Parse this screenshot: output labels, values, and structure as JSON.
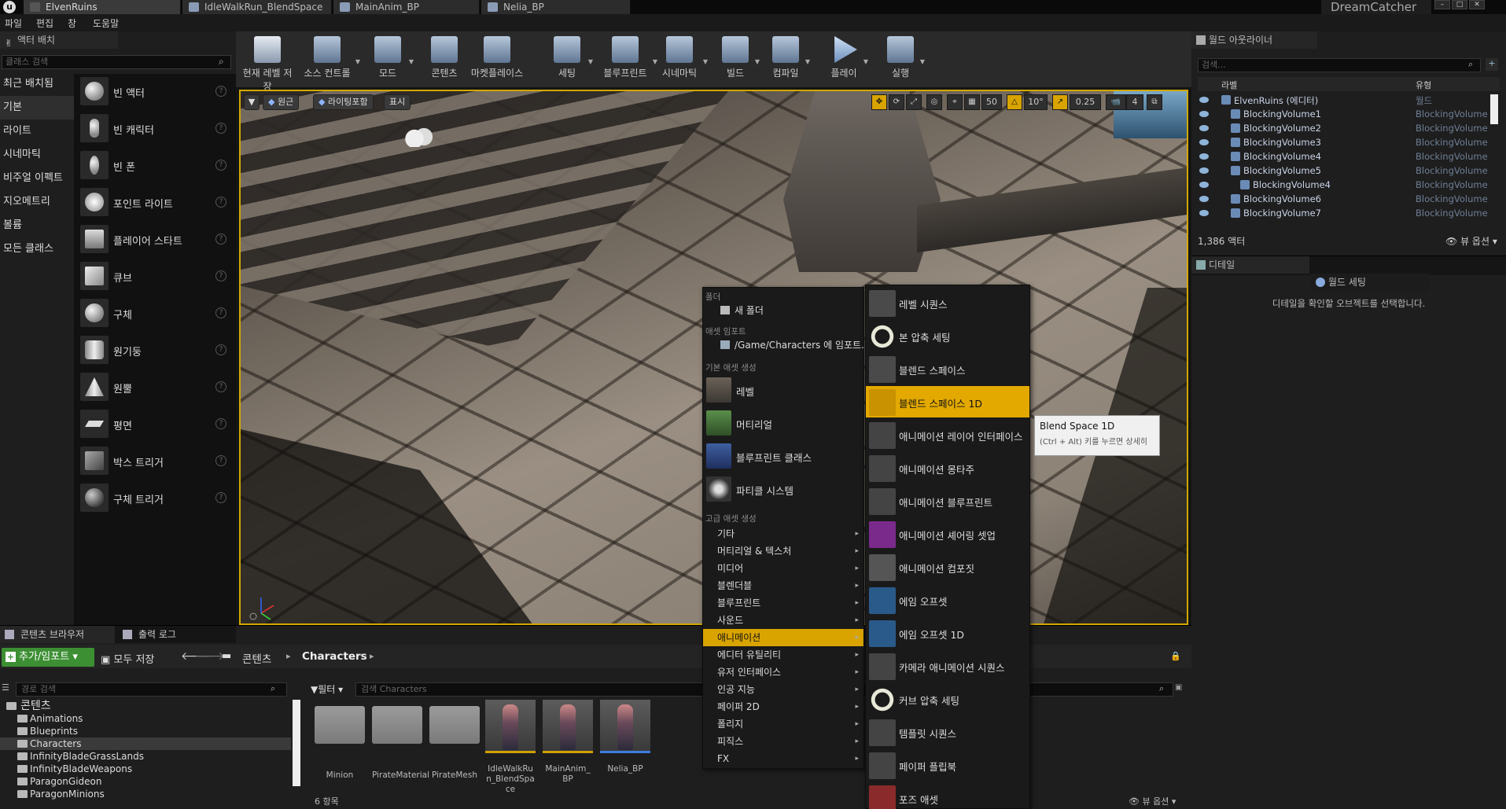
{
  "titlebar": {
    "tabs": [
      {
        "label": "ElvenRuins"
      },
      {
        "label": "IdleWalkRun_BlendSpace"
      },
      {
        "label": "MainAnim_BP"
      },
      {
        "label": "Nelia_BP"
      }
    ],
    "project": "DreamCatcher"
  },
  "menubar": {
    "items": [
      "파일",
      "편집",
      "창",
      "도움말"
    ]
  },
  "modes": {
    "tab": "액터 배치",
    "search_placeholder": "클래스 검색",
    "categories": [
      "최근 배치됨",
      "기본",
      "라이트",
      "시네마틱",
      "비주얼 이펙트",
      "지오메트리",
      "볼륨",
      "모든 클래스"
    ],
    "items": [
      "빈 액터",
      "빈 캐릭터",
      "빈 폰",
      "포인트 라이트",
      "플레이어 스타트",
      "큐브",
      "구체",
      "원기둥",
      "원뿔",
      "평면",
      "박스 트리거",
      "구체 트리거"
    ]
  },
  "toolbar": {
    "buttons": [
      "현재 레벨 저장",
      "소스 컨트롤",
      "모드",
      "콘텐츠",
      "마켓플레이스",
      "세팅",
      "블루프린트",
      "시네마틱",
      "빌드",
      "컴파일",
      "플레이",
      "실행"
    ]
  },
  "viewport": {
    "perspective": "원근",
    "lighting": "라이팅포함",
    "show": "표시",
    "grid_snap": "50",
    "rot_snap": "10°",
    "scale_snap": "0.25",
    "cam_speed": "4"
  },
  "outliner": {
    "tab": "월드 아웃라이너",
    "search_placeholder": "검색...",
    "col_label": "라벨",
    "col_type": "유형",
    "rows": [
      {
        "label": "ElvenRuins (에디터)",
        "type": "월드",
        "indent": 0
      },
      {
        "label": "BlockingVolume1",
        "type": "BlockingVolume",
        "indent": 1
      },
      {
        "label": "BlockingVolume2",
        "type": "BlockingVolume",
        "indent": 1
      },
      {
        "label": "BlockingVolume3",
        "type": "BlockingVolume",
        "indent": 1
      },
      {
        "label": "BlockingVolume4",
        "type": "BlockingVolume",
        "indent": 1
      },
      {
        "label": "BlockingVolume5",
        "type": "BlockingVolume",
        "indent": 1
      },
      {
        "label": "BlockingVolume4",
        "type": "BlockingVolume",
        "indent": 2
      },
      {
        "label": "BlockingVolume6",
        "type": "BlockingVolume",
        "indent": 1
      },
      {
        "label": "BlockingVolume7",
        "type": "BlockingVolume",
        "indent": 1
      }
    ],
    "actor_count": "1,386 액터",
    "view_options": "뷰 옵션"
  },
  "details": {
    "tab": "디테일",
    "tab2": "월드 세팅",
    "empty_msg": "디테일을 확인할 오브젝트를 선택합니다."
  },
  "content_browser": {
    "tab": "콘텐츠 브라우저",
    "tab2": "출력 로그",
    "add_import": "추가/임포트",
    "save_all": "모두 저장",
    "crumb_root": "콘텐츠",
    "crumb_current": "Characters",
    "path_search_placeholder": "경로 검색",
    "filter": "필터",
    "asset_search_placeholder": "검색 Characters",
    "tree": [
      "콘텐츠",
      "Animations",
      "Blueprints",
      "Characters",
      "InfinityBladeGrassLands",
      "InfinityBladeWeapons",
      "ParagonGideon",
      "ParagonMinions"
    ],
    "assets": [
      "Minion",
      "PirateMaterial",
      "PirateMesh",
      "IdleWalkRun_BlendSpace",
      "MainAnim_BP",
      "Nelia_BP"
    ],
    "item_count": "6 항목",
    "view_options": "뷰 옵션"
  },
  "context_menu": {
    "sec_folder": "폴더",
    "new_folder": "새 폴더",
    "sec_import": "애셋 임포트",
    "import_path": "/Game/Characters 에 임포트...",
    "sec_basic": "기본 애셋 생성",
    "basic": [
      "레벨",
      "머티리얼",
      "블루프린트 클래스",
      "파티클 시스템"
    ],
    "sec_advanced": "고급 애셋 생성",
    "advanced": [
      "기타",
      "머티리얼 & 텍스처",
      "미디어",
      "블렌더블",
      "블루프린트",
      "사운드",
      "애니메이션",
      "에디터 유틸리티",
      "유저 인터페이스",
      "인공 지능",
      "페이퍼 2D",
      "폴리지",
      "피직스",
      "FX"
    ],
    "highlighted": "애니메이션"
  },
  "submenu": {
    "items": [
      "레벨 시퀀스",
      "본 압축 세팅",
      "블렌드 스페이스",
      "블렌드 스페이스 1D",
      "애니메이션 레이어 인터페이스",
      "애니메이션 몽타주",
      "애니메이션 블루프린트",
      "애니메이션 셰어링 셋업",
      "애니메이션 컴포짓",
      "에임 오프셋",
      "에임 오프셋 1D",
      "카메라 애니메이션 시퀀스",
      "커브 압축 세팅",
      "템플릿 시퀀스",
      "페이퍼 플립북",
      "포즈 애셋"
    ],
    "highlighted": "블렌드 스페이스 1D"
  },
  "tooltip": {
    "title": "Blend Space 1D",
    "hint": "(Ctrl + Alt) 키를 누르면 상세히"
  },
  "colors": {
    "accent": "#e3a900",
    "add_button": "#3c8f33",
    "viewport_border": "#d2a800"
  }
}
